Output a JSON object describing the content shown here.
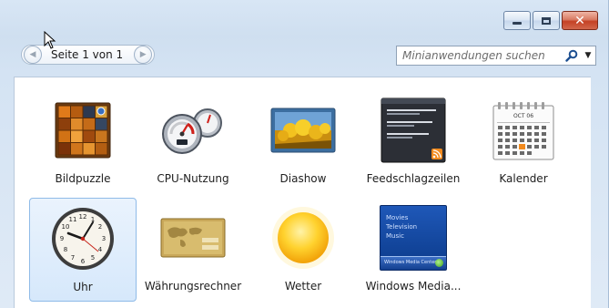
{
  "window": {
    "caption_buttons": [
      {
        "name": "minimize-button"
      },
      {
        "name": "maximize-button"
      },
      {
        "name": "close-button"
      }
    ]
  },
  "toolbar": {
    "page_label": "Seite 1 von 1",
    "search_placeholder": "Minianwendungen suchen"
  },
  "gadgets": [
    {
      "label": "Bildpuzzle",
      "icon": "puzzle-icon"
    },
    {
      "label": "CPU-Nutzung",
      "icon": "cpu-meter-icon"
    },
    {
      "label": "Diashow",
      "icon": "slideshow-icon"
    },
    {
      "label": "Feedschlagzeilen",
      "icon": "feed-headlines-icon"
    },
    {
      "label": "Kalender",
      "icon": "calendar-icon",
      "month": "OCT 06"
    },
    {
      "label": "Uhr",
      "icon": "clock-icon",
      "selected": true
    },
    {
      "label": "Währungsrechner",
      "icon": "currency-icon"
    },
    {
      "label": "Wetter",
      "icon": "weather-sun-icon"
    },
    {
      "label": "Windows Media...",
      "icon": "media-center-icon",
      "menu": [
        "Movies",
        "Television",
        "Music"
      ],
      "bar": "Windows Media Center"
    }
  ]
}
